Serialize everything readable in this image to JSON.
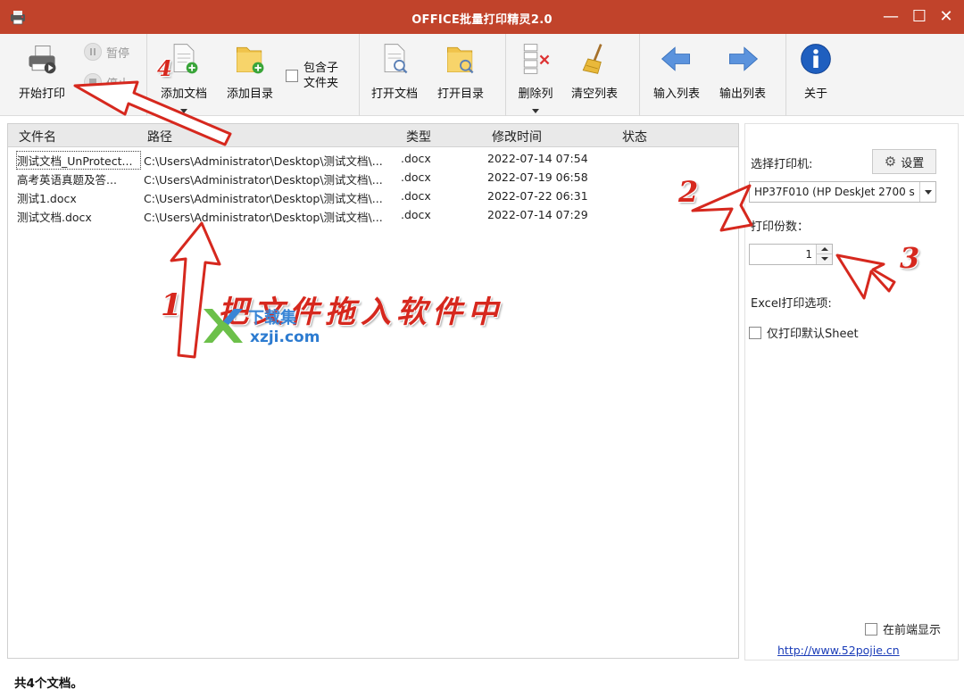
{
  "window": {
    "title": "OFFICE批量打印精灵2.0",
    "minimize": "—",
    "maximize": "☐",
    "close": "✕"
  },
  "toolbar": {
    "start_print": "开始打印",
    "pause": "暂停",
    "stop": "停止",
    "add_doc": "添加文档",
    "add_dir": "添加目录",
    "include_sub_line1": "包含子",
    "include_sub_line2": "文件夹",
    "open_doc": "打开文档",
    "open_dir": "打开目录",
    "delete_col": "删除列",
    "clear_list": "清空列表",
    "import_list": "输入列表",
    "export_list": "输出列表",
    "about": "关于"
  },
  "list": {
    "columns": [
      "文件名",
      "路径",
      "类型",
      "修改时间",
      "状态"
    ],
    "rows": [
      {
        "name": "测试文档_UnProtect...",
        "path": "C:\\Users\\Administrator\\Desktop\\测试文档\\...",
        "type": ".docx",
        "modified": "2022-07-14 07:54",
        "status": ""
      },
      {
        "name": "高考英语真题及答...",
        "path": "C:\\Users\\Administrator\\Desktop\\测试文档\\...",
        "type": ".docx",
        "modified": "2022-07-19 06:58",
        "status": ""
      },
      {
        "name": "测试1.docx",
        "path": "C:\\Users\\Administrator\\Desktop\\测试文档\\...",
        "type": ".docx",
        "modified": "2022-07-22 06:31",
        "status": ""
      },
      {
        "name": "测试文档.docx",
        "path": "C:\\Users\\Administrator\\Desktop\\测试文档\\...",
        "type": ".docx",
        "modified": "2022-07-14 07:29",
        "status": ""
      }
    ]
  },
  "right_panel": {
    "select_printer_label": "选择打印机:",
    "settings_button": "设置",
    "printer_value": "HP37F010 (HP DeskJet 2700 s",
    "copies_label": "打印份数：",
    "copies_value": "1",
    "excel_options_label": "Excel打印选项:",
    "only_default_sheet": "仅打印默认Sheet",
    "on_top": "在前端显示",
    "link": "http://www.52pojie.cn"
  },
  "status": {
    "text": "共4个文档。"
  },
  "annotations": {
    "n1": "1",
    "n2": "2",
    "n3": "3",
    "n4": "4",
    "drag_hint": "把文件拖入软件中",
    "watermark_title": "下载集",
    "watermark_url": "xzji.com"
  },
  "colors": {
    "titlebar": "#c1432b",
    "annotation": "#d6281e",
    "link": "#1a3cb8"
  }
}
